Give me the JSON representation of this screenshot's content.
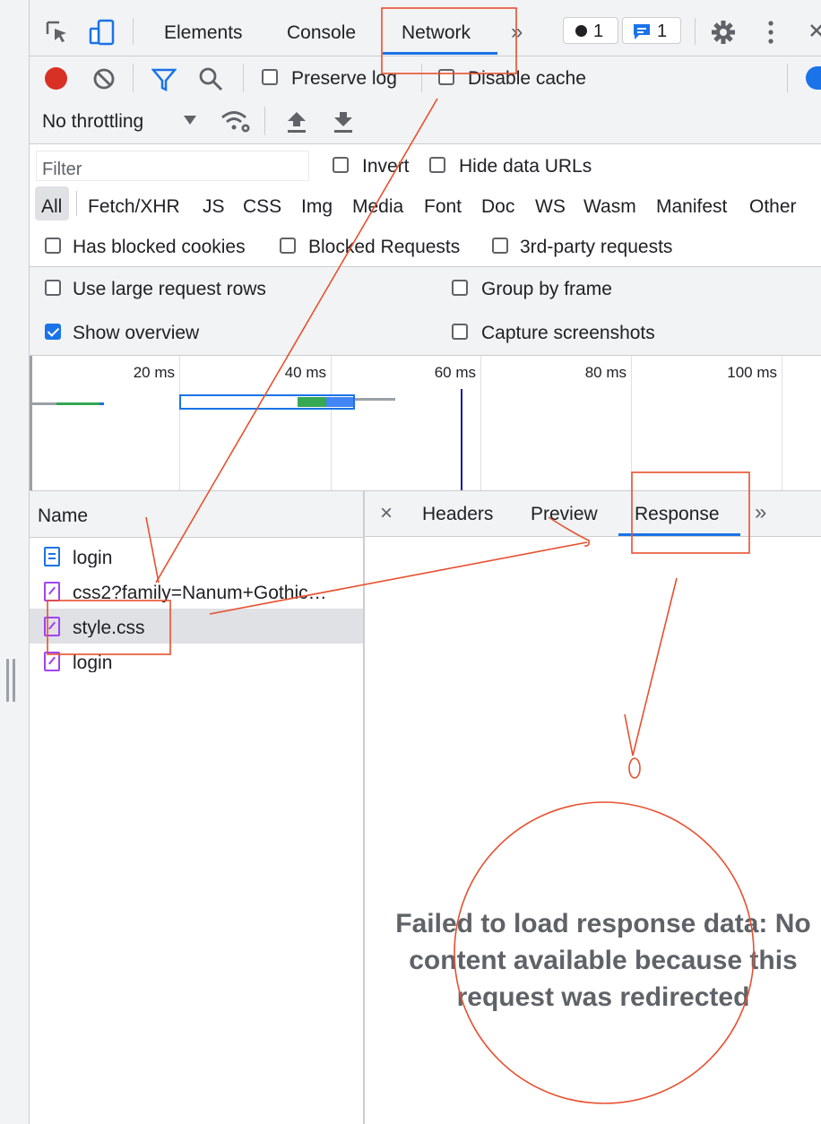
{
  "tabs": {
    "items": [
      "Elements",
      "Console",
      "Network"
    ],
    "active": "Network",
    "more": "»",
    "errors_count": "1",
    "messages_count": "1"
  },
  "toolbar": {
    "preserve_log": "Preserve log",
    "disable_cache": "Disable cache",
    "throttling": "No throttling"
  },
  "filters": {
    "placeholder": "Filter",
    "invert": "Invert",
    "hide_data_urls": "Hide data URLs",
    "types": [
      "All",
      "Fetch/XHR",
      "JS",
      "CSS",
      "Img",
      "Media",
      "Font",
      "Doc",
      "WS",
      "Wasm",
      "Manifest",
      "Other"
    ],
    "has_blocked_cookies": "Has blocked cookies",
    "blocked_requests": "Blocked Requests",
    "third_party": "3rd-party requests"
  },
  "settings": {
    "large_rows": "Use large request rows",
    "group_by_frame": "Group by frame",
    "show_overview": "Show overview",
    "show_overview_checked": true,
    "capture_screenshots": "Capture screenshots"
  },
  "overview": {
    "ticks": [
      "20 ms",
      "40 ms",
      "60 ms",
      "80 ms",
      "100 ms"
    ]
  },
  "requests": {
    "header": "Name",
    "rows": [
      {
        "name": "login",
        "type": "document",
        "selected": false
      },
      {
        "name": "css2?family=Nanum+Gothic…",
        "type": "stylesheet",
        "selected": false
      },
      {
        "name": "style.css",
        "type": "stylesheet",
        "selected": true
      },
      {
        "name": "login",
        "type": "stylesheet",
        "selected": false
      }
    ]
  },
  "detail": {
    "close": "×",
    "tabs": [
      "Headers",
      "Preview",
      "Response"
    ],
    "active": "Response",
    "more": "»",
    "message": "Failed to load response data: No content available because this request was redirected"
  },
  "colors": {
    "accent": "#1a73e8",
    "record": "#d93025",
    "annotation": "#e8502f",
    "stylesheet_icon": "#a142f4",
    "document_icon": "#1a73e8"
  }
}
